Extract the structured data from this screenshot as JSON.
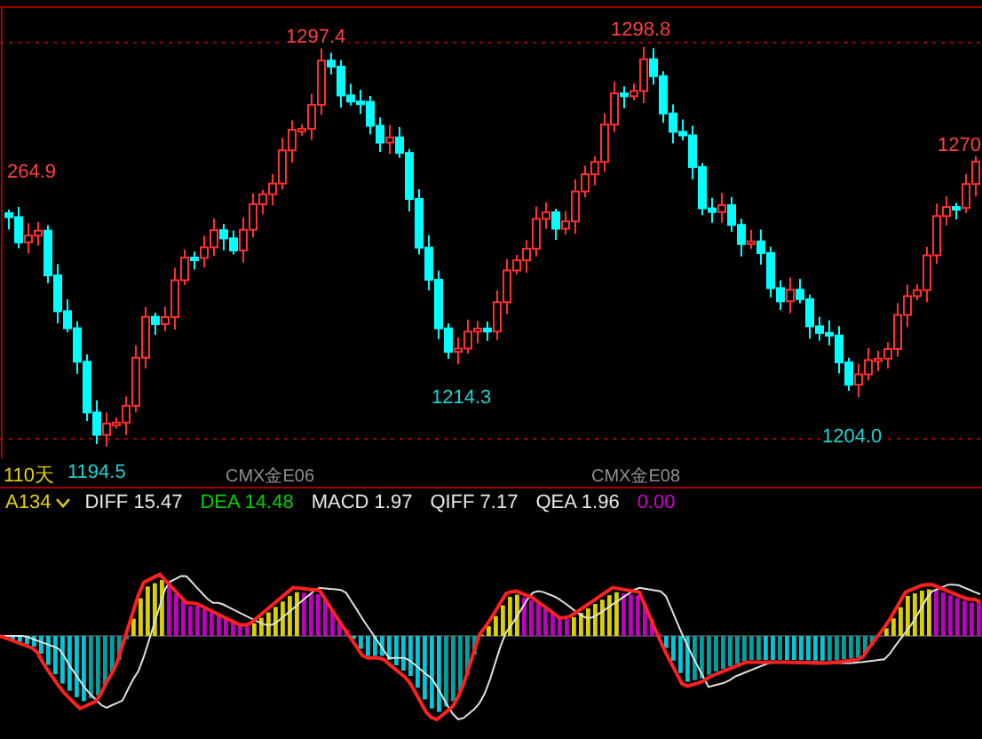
{
  "price_chart": {
    "labels": [
      {
        "text": "1297.4",
        "kind": "high"
      },
      {
        "text": "1298.8",
        "kind": "high"
      },
      {
        "text": "264.9",
        "kind": "high"
      },
      {
        "text": "1270",
        "kind": "high"
      },
      {
        "text": "1214.3",
        "kind": "low"
      },
      {
        "text": "1204.0",
        "kind": "low"
      }
    ]
  },
  "time_row": {
    "period": "110天",
    "low_label": "1194.5",
    "contracts": [
      "CMX金E06",
      "CMX金E08"
    ]
  },
  "indicator_bar": {
    "name": "A134",
    "values": [
      {
        "text": "DIFF 15.47",
        "color": "#e8e8e8"
      },
      {
        "text": "DEA 14.48",
        "color": "#00d000"
      },
      {
        "text": "MACD 1.97",
        "color": "#e8e8e8"
      },
      {
        "text": "QIFF 7.17",
        "color": "#e8e8e8"
      },
      {
        "text": "QEA 1.96",
        "color": "#e8e8e8"
      },
      {
        "text": "0.00",
        "color": "#d000d0"
      }
    ]
  }
}
